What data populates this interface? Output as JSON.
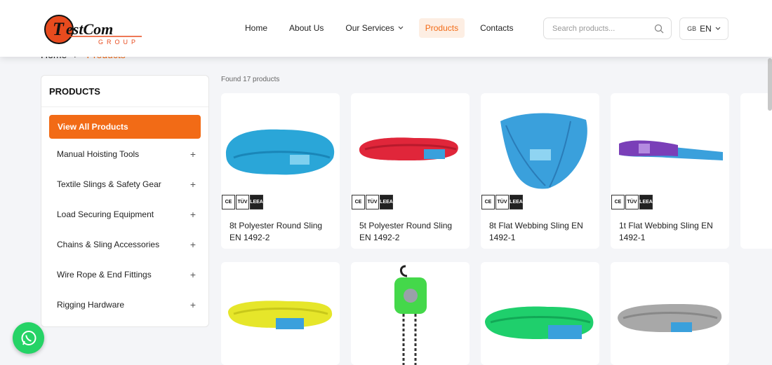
{
  "brand": {
    "logo_text": "TestCom",
    "logo_sub": "GROUP"
  },
  "nav": {
    "items": [
      {
        "label": "Home",
        "active": false,
        "dropdown": false
      },
      {
        "label": "About Us",
        "active": false,
        "dropdown": false
      },
      {
        "label": "Our Services",
        "active": false,
        "dropdown": true
      },
      {
        "label": "Products",
        "active": true,
        "dropdown": false
      },
      {
        "label": "Contacts",
        "active": false,
        "dropdown": false
      }
    ]
  },
  "search": {
    "placeholder": "Search products...",
    "icon": "search-icon"
  },
  "language": {
    "flag": "GB",
    "code": "EN"
  },
  "breadcrumb": {
    "home": "Home",
    "separator": ">",
    "current": "Products"
  },
  "sidebar": {
    "title": "PRODUCTS",
    "all_label": "View All Products",
    "categories": [
      "Manual Hoisting Tools",
      "Textile Slings & Safety Gear",
      "Load Securing Equipment",
      "Chains & Sling Accessories",
      "Wire Rope & End Fittings",
      "Rigging Hardware"
    ],
    "expand_symbol": "+"
  },
  "results": {
    "found_text": "Found 17 products"
  },
  "products": [
    {
      "name": "8t Polyester Round Sling EN 1492-2",
      "color": "#2aa6d8"
    },
    {
      "name": "5t Polyester Round Sling EN 1492-2",
      "color": "#e0263a"
    },
    {
      "name": "8t Flat Webbing Sling EN 1492-1",
      "color": "#3aa0dc"
    },
    {
      "name": "1t Flat Webbing Sling EN 1492-1",
      "color": "#7a3fb8"
    },
    {
      "name": "",
      "color": "#e6e62a"
    },
    {
      "name": "",
      "color": "#44d84a"
    },
    {
      "name": "",
      "color": "#1fcf6c"
    },
    {
      "name": "",
      "color": "#a8a8a8"
    }
  ],
  "certifications": [
    "CE",
    "TÜV",
    "LEEA"
  ],
  "colors": {
    "accent": "#f26b16",
    "accent_light": "#fdeee3",
    "whatsapp": "#25d366"
  }
}
